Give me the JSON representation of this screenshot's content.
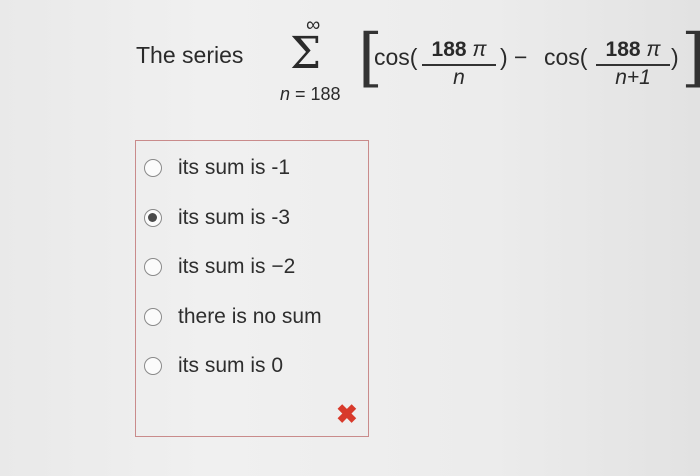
{
  "question": {
    "lead_text": "The series",
    "sum_symbol": "Σ",
    "upper_limit": "∞",
    "lower_limit_var": "n",
    "lower_limit_rest": " = 188",
    "cos1": "cos(",
    "close1": ") −",
    "cos2": "cos(",
    "close2": ")",
    "frac1_num": "188",
    "frac1_den": "n",
    "frac2_num": "188",
    "frac2_den": "n+1",
    "pi": "π",
    "left_bracket": "[",
    "right_bracket": "]"
  },
  "options": [
    {
      "label": "its sum is -1",
      "selected": false
    },
    {
      "label": "its sum is -3",
      "selected": true
    },
    {
      "label": "its sum is −2",
      "selected": false
    },
    {
      "label": "there is no sum",
      "selected": false
    },
    {
      "label": "its sum is 0",
      "selected": false
    }
  ],
  "feedback": {
    "icon": "incorrect-x-icon",
    "symbol": "✖",
    "color": "#d83a2b"
  }
}
